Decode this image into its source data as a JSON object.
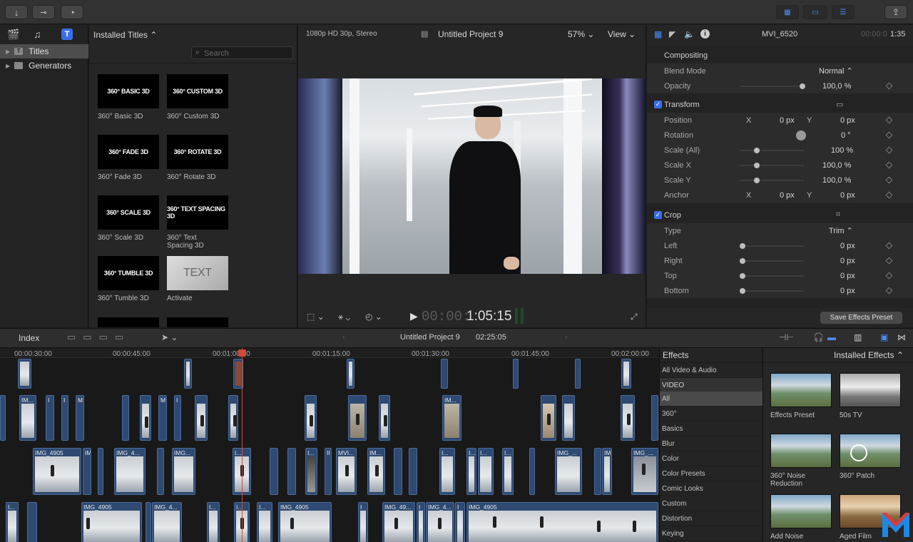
{
  "toolbar": {
    "import_icon": "download-icon",
    "keywords_icon": "key-icon",
    "bg_tasks_icon": "progress-icon",
    "share_icon": "share-icon"
  },
  "library": {
    "tabs": [
      "photos-icon",
      "music-icon",
      "titles-icon"
    ],
    "items": [
      {
        "label": "Titles",
        "icon": "T"
      },
      {
        "label": "Generators",
        "icon": "G"
      }
    ]
  },
  "browser": {
    "header": "Installed Titles ⌃",
    "search_placeholder": "Search",
    "titles": [
      {
        "thumb": "360° BASIC 3D",
        "caption": "360° Basic 3D"
      },
      {
        "thumb": "360° CUSTOM 3D",
        "caption": "360° Custom 3D"
      },
      {
        "thumb": "360° FADE 3D",
        "caption": "360° Fade 3D"
      },
      {
        "thumb": "360° ROTATE 3D",
        "caption": "360° Rotate 3D"
      },
      {
        "thumb": "360° SCALE 3D",
        "caption": "360° Scale 3D"
      },
      {
        "thumb": "360° TEXT SPACING 3D",
        "caption": "360° Text\nSpacing 3D"
      },
      {
        "thumb": "360° TUMBLE 3D",
        "caption": "360° Tumble 3D"
      },
      {
        "thumb": "TEXT",
        "caption": "Activate"
      }
    ]
  },
  "viewer": {
    "format": "1080p HD 30p, Stereo",
    "project": "Untitled Project 9",
    "zoom": "57% ⌄",
    "view": "View ⌄",
    "timecode_dim": "00:00:",
    "timecode": "1:05:15"
  },
  "inspector": {
    "clip_name": "MVI_6520",
    "duration_dim": "00:00:0",
    "duration": "1:35",
    "compositing": "Compositing",
    "blend_mode_label": "Blend Mode",
    "blend_mode_value": "Normal ⌃",
    "opacity_label": "Opacity",
    "opacity_value": "100,0 %",
    "transform": "Transform",
    "position_label": "Position",
    "x": "X",
    "y": "Y",
    "pos_x": "0 px",
    "pos_y": "0 px",
    "rotation_label": "Rotation",
    "rotation_value": "0 °",
    "scale_all_label": "Scale (All)",
    "scale_all_value": "100 %",
    "scale_x_label": "Scale X",
    "scale_x_value": "100,0 %",
    "scale_y_label": "Scale Y",
    "scale_y_value": "100,0 %",
    "anchor_label": "Anchor",
    "anchor_x": "0 px",
    "anchor_y": "0 px",
    "crop": "Crop",
    "type_label": "Type",
    "type_value": "Trim ⌃",
    "left_label": "Left",
    "left_value": "0 px",
    "right_label": "Right",
    "right_value": "0 px",
    "top_label": "Top",
    "top_value": "0 px",
    "bottom_label": "Bottom",
    "bottom_value": "0 px",
    "save_preset": "Save Effects Preset"
  },
  "timeline_bar": {
    "index": "Index",
    "project": "Untitled Project 9",
    "duration": "02:25:05"
  },
  "ruler": [
    "00:00:30:00",
    "00:00:45:00",
    "00:01:00:00",
    "00:01:15:00",
    "00:01:30:00",
    "00:01:45:00",
    "00:02:00:00"
  ],
  "clip_labels": {
    "a": "IMG_4905",
    "b": "IMG_4...",
    "c": "IMG...",
    "d": "MVI...",
    "e": "IMG_49...",
    "f": "IM...",
    "g": "I...",
    "h": "IMG_..."
  },
  "effects": {
    "header": "Effects",
    "categories": [
      "All Video & Audio",
      "VIDEO",
      "All",
      "360°",
      "Basics",
      "Blur",
      "Color",
      "Color Presets",
      "Comic Looks",
      "Custom",
      "Distortion",
      "Keying"
    ],
    "installed": "Installed Effects ⌃",
    "items": [
      {
        "caption": "Effects Preset"
      },
      {
        "caption": "50s TV"
      },
      {
        "caption": "360° Noise\nReduction"
      },
      {
        "caption": "360° Patch"
      },
      {
        "caption": "Add Noise"
      },
      {
        "caption": "Aged Film"
      }
    ]
  },
  "colors": {
    "accent": "#3a6ee8",
    "clip": "#2e4a72",
    "playhead": "#d24a3a"
  }
}
